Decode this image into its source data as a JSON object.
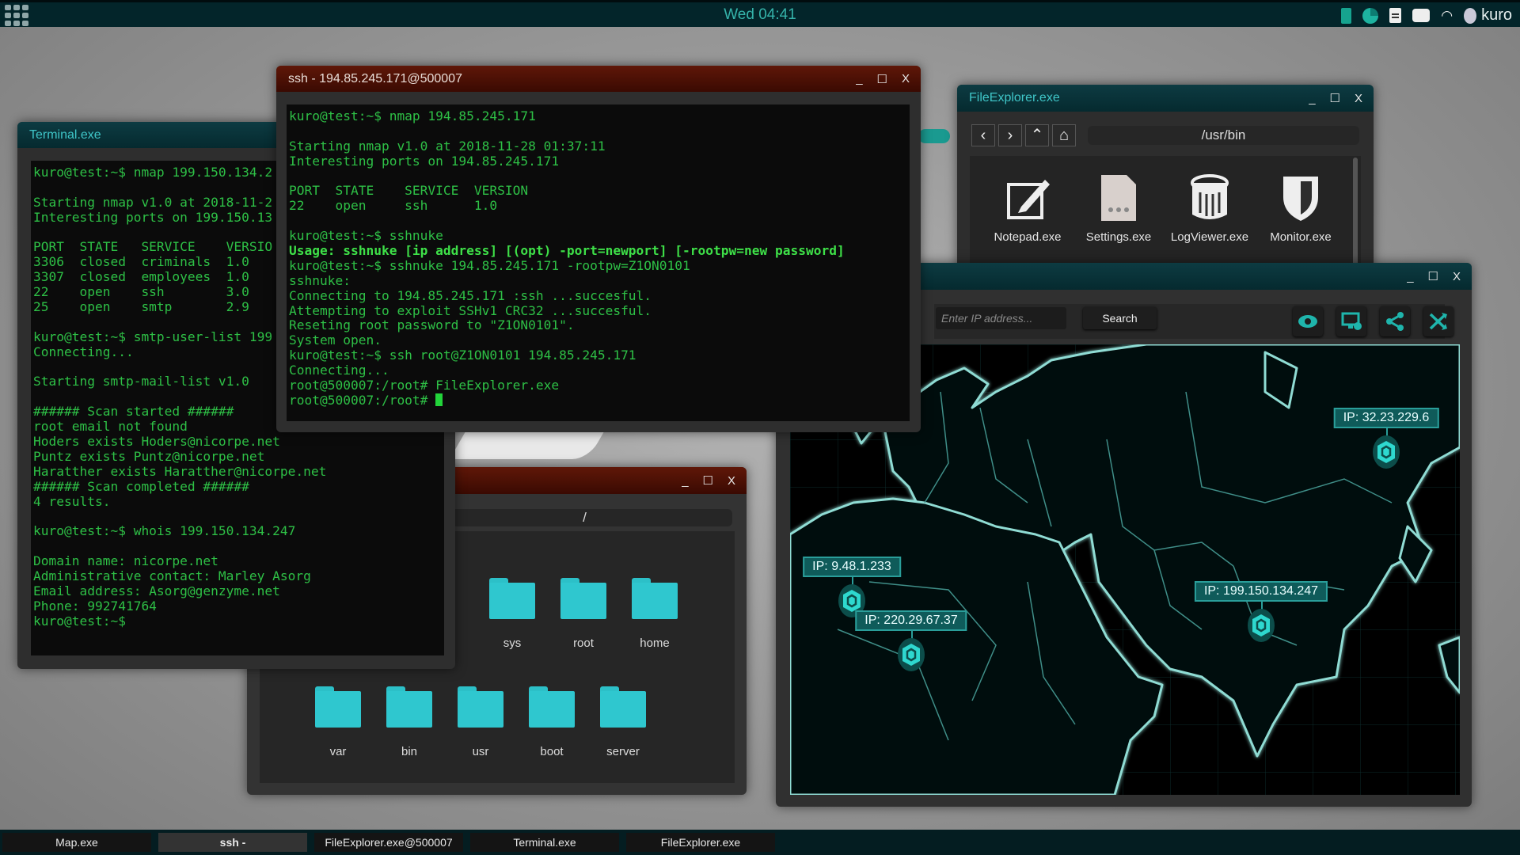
{
  "topbar": {
    "clock": "Wed 04:41",
    "user": "kuro",
    "icons": [
      "apps-grid-icon",
      "battery-icon",
      "pie-status-icon",
      "clipboard-icon",
      "chat-icon",
      "wifi-icon",
      "user-avatar-icon"
    ]
  },
  "terminal": {
    "title": "Terminal.exe",
    "lines": [
      "kuro@test:~$ nmap 199.150.134.2",
      "",
      "Starting nmap v1.0 at 2018-11-2",
      "Interesting ports on 199.150.13",
      "",
      "PORT  STATE   SERVICE    VERSIO",
      "3306  closed  criminals  1.0",
      "3307  closed  employees  1.0",
      "22    open    ssh        3.0",
      "25    open    smtp       2.9",
      "",
      "kuro@test:~$ smtp-user-list 199",
      "Connecting...",
      "",
      "Starting smtp-mail-list v1.0",
      "",
      "###### Scan started ######",
      "root email not found",
      "Hoders exists Hoders@nicorpe.net",
      "Puntz exists Puntz@nicorpe.net",
      "Haratther exists Haratther@nicorpe.net",
      "###### Scan completed ######",
      "4 results.",
      "",
      "kuro@test:~$ whois 199.150.134.247",
      "",
      "Domain name: nicorpe.net",
      "Administrative contact: Marley Asorg",
      "Email address: Asorg@genzyme.net",
      "Phone: 992741764",
      "kuro@test:~$"
    ]
  },
  "ssh": {
    "title": "ssh - 194.85.245.171@500007",
    "lines": [
      "kuro@test:~$ nmap 194.85.245.171",
      "",
      "Starting nmap v1.0 at 2018-11-28 01:37:11",
      "Interesting ports on 194.85.245.171",
      "",
      "PORT  STATE    SERVICE  VERSION",
      "22    open     ssh      1.0",
      "",
      "kuro@test:~$ sshnuke",
      "Usage: sshnuke [ip address] [(opt) -port=newport] [-rootpw=new password]",
      "kuro@test:~$ sshnuke 194.85.245.171 -rootpw=Z1ON0101",
      "sshnuke:",
      "Connecting to 194.85.245.171 :ssh ...succesful.",
      "Attempting to exploit SSHv1 CRC32 ...succesful.",
      "Reseting root password to \"Z1ON0101\".",
      "System open.",
      "kuro@test:~$ ssh root@Z1ON0101 194.85.245.171",
      "Connecting...",
      "root@500007:/root# FileExplorer.exe",
      "root@500007:/root# "
    ],
    "bold_line": 9
  },
  "window_controls": {
    "minimize": "_",
    "maximize": "☐",
    "close": "X"
  },
  "root_explorer": {
    "path": "/",
    "folders": [
      "sys",
      "root",
      "home",
      "var",
      "bin",
      "usr",
      "boot",
      "server"
    ]
  },
  "bin_explorer": {
    "title": "FileExplorer.exe",
    "path": "/usr/bin",
    "nav": [
      "‹",
      "›",
      "⌃",
      "⌂"
    ],
    "apps": [
      "Notepad.exe",
      "Settings.exe",
      "LogViewer.exe",
      "Monitor.exe"
    ]
  },
  "map": {
    "ip_placeholder": "Enter IP address...",
    "search_label": "Search",
    "tools": [
      "eye-icon",
      "monitor-add-icon",
      "share-icon",
      "shuffle-icon"
    ],
    "markers": [
      "IP: 32.23.229.6",
      "IP: 9.48.1.233",
      "IP: 220.29.67.37",
      "IP: 199.150.134.247"
    ],
    "accent": "#2ec6c0"
  },
  "taskbar": {
    "items": [
      "Map.exe",
      "ssh -",
      "FileExplorer.exe@500007",
      "Terminal.exe",
      "FileExplorer.exe"
    ],
    "active": 1
  }
}
